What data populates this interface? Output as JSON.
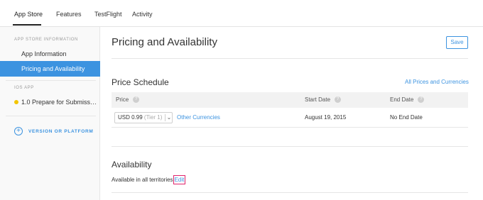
{
  "topnav": {
    "tabs": [
      {
        "label": "App Store",
        "active": true
      },
      {
        "label": "Features",
        "active": false
      },
      {
        "label": "TestFlight",
        "active": false
      },
      {
        "label": "Activity",
        "active": false
      }
    ]
  },
  "sidebar": {
    "section1_header": "APP STORE INFORMATION",
    "items": [
      {
        "label": "App Information",
        "active": false
      },
      {
        "label": "Pricing and Availability",
        "active": true
      }
    ],
    "section2_header": "IOS APP",
    "version_item": {
      "label": "1.0 Prepare for Submiss…",
      "status": "yellow-dot"
    },
    "add_version_label": "VERSION OR PLATFORM",
    "add_version_icon": "plus-circle-icon"
  },
  "main": {
    "title": "Pricing and Availability",
    "save_label": "Save",
    "price_schedule": {
      "title": "Price Schedule",
      "all_prices_link": "All Prices and Currencies",
      "columns": [
        "Price",
        "Start Date",
        "End Date"
      ],
      "row": {
        "price_value": "USD 0.99",
        "tier": "(Tier 1)",
        "other_currencies": "Other Currencies",
        "start_date": "August 19, 2015",
        "end_date": "No End Date"
      }
    },
    "availability": {
      "title": "Availability",
      "text": "Available in all territories",
      "edit_link": "Edit"
    }
  },
  "colors": {
    "accent": "#3c93e0",
    "highlight_box": "#e0236b",
    "status_dot": "#f2c500"
  }
}
